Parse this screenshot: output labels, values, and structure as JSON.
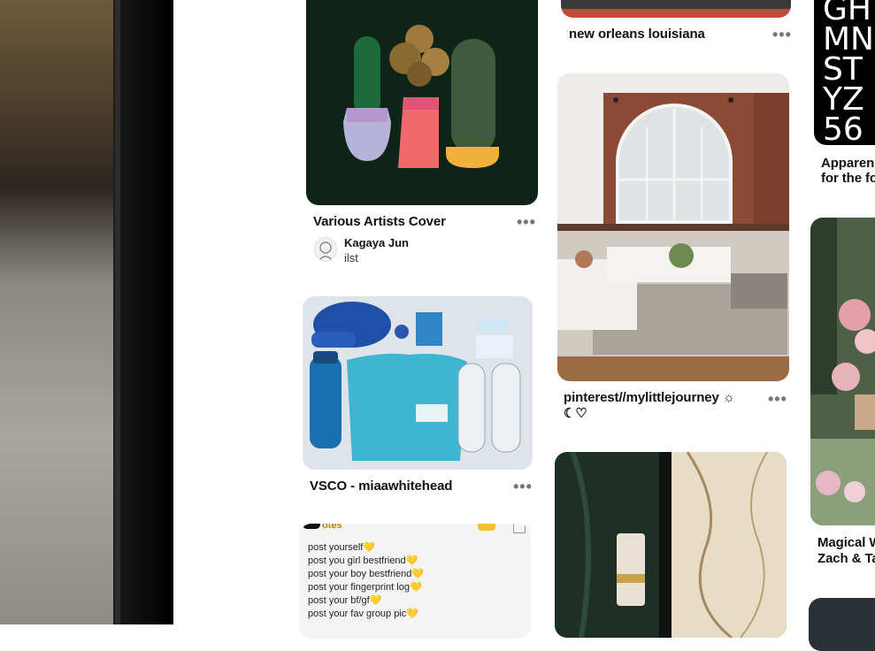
{
  "pins": {
    "top_center": {
      "title": "new orleans louisiana",
      "more": "•••"
    },
    "various_artists": {
      "title": "Various Artists Cover",
      "more": "•••",
      "author": {
        "name": "Kagaya Jun",
        "subtitle": "ilst"
      }
    },
    "vsco": {
      "title": "VSCO - miaawhitehead",
      "more": "•••"
    },
    "interior": {
      "title_line1": "pinterest//mylittlejourney ☼",
      "title_line2": "☾♡",
      "more": "•••"
    },
    "typography": {
      "title_line1": "Apparen",
      "title_line2": "for the fo",
      "letters": [
        "GH",
        "MN",
        "ST",
        "YZ",
        "56"
      ]
    },
    "flowers": {
      "title_line1": "Magical W",
      "title_line2": "Zach & Ta"
    },
    "notes": {
      "header": "otes",
      "lines": [
        "post yourself💛",
        "post you girl bestfriend💛",
        "post your boy bestfriend💛",
        "post your fingerprint log💛",
        "post your bf/gf💛",
        "post your fav group pic💛"
      ]
    }
  },
  "colors": {
    "text": "#111111",
    "muted": "#767676",
    "cactus_bg": "#0f2418"
  }
}
